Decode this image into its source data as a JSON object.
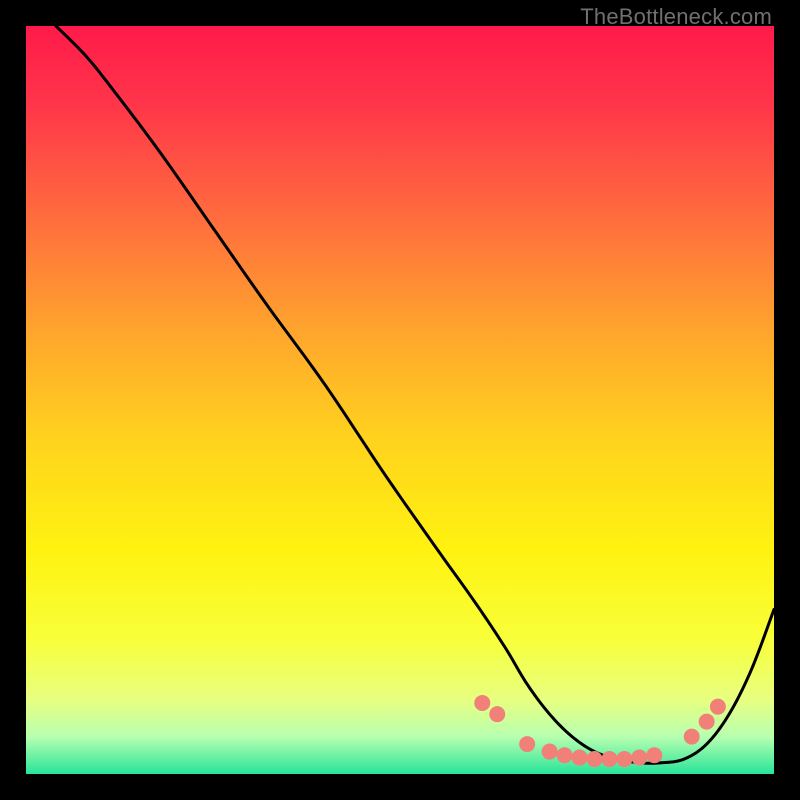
{
  "watermark": "TheBottleneck.com",
  "chart_data": {
    "type": "line",
    "title": "",
    "xlabel": "",
    "ylabel": "",
    "xlim": [
      0,
      100
    ],
    "ylim": [
      0,
      100
    ],
    "grid": false,
    "legend": false,
    "background_gradient": {
      "stops": [
        {
          "offset": 0.0,
          "color": "#ff1a4a"
        },
        {
          "offset": 0.1,
          "color": "#ff344a"
        },
        {
          "offset": 0.25,
          "color": "#ff6a3e"
        },
        {
          "offset": 0.4,
          "color": "#ffa22e"
        },
        {
          "offset": 0.55,
          "color": "#ffd21e"
        },
        {
          "offset": 0.7,
          "color": "#fff210"
        },
        {
          "offset": 0.82,
          "color": "#f8ff3a"
        },
        {
          "offset": 0.9,
          "color": "#e8ff80"
        },
        {
          "offset": 0.95,
          "color": "#b8ffb0"
        },
        {
          "offset": 1.0,
          "color": "#28e49a"
        }
      ]
    },
    "series": [
      {
        "name": "curve",
        "x": [
          4,
          8,
          12,
          18,
          25,
          32,
          40,
          48,
          55,
          60,
          64,
          67,
          70,
          73,
          76,
          79,
          82,
          85,
          88,
          91,
          94,
          97,
          100
        ],
        "y": [
          100,
          96,
          91,
          83,
          73,
          63,
          52,
          40,
          30,
          23,
          17,
          12,
          8,
          5,
          3,
          2,
          1.5,
          1.5,
          2,
          4,
          8,
          14,
          22
        ]
      }
    ],
    "markers": {
      "name": "dots",
      "color": "#f08078",
      "radius": 8,
      "points": [
        {
          "x": 61,
          "y": 9.5
        },
        {
          "x": 63,
          "y": 8.0
        },
        {
          "x": 67,
          "y": 4.0
        },
        {
          "x": 70,
          "y": 3.0
        },
        {
          "x": 72,
          "y": 2.5
        },
        {
          "x": 74,
          "y": 2.2
        },
        {
          "x": 76,
          "y": 2.0
        },
        {
          "x": 78,
          "y": 2.0
        },
        {
          "x": 80,
          "y": 2.0
        },
        {
          "x": 82,
          "y": 2.2
        },
        {
          "x": 84,
          "y": 2.5
        },
        {
          "x": 89,
          "y": 5.0
        },
        {
          "x": 91,
          "y": 7.0
        },
        {
          "x": 92.5,
          "y": 9.0
        }
      ]
    }
  }
}
